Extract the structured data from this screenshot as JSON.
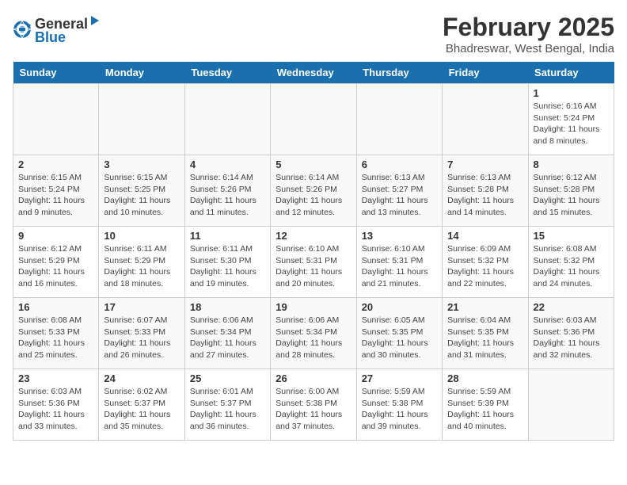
{
  "app": {
    "name_general": "General",
    "name_blue": "Blue"
  },
  "title": "February 2025",
  "subtitle": "Bhadreswar, West Bengal, India",
  "days_of_week": [
    "Sunday",
    "Monday",
    "Tuesday",
    "Wednesday",
    "Thursday",
    "Friday",
    "Saturday"
  ],
  "weeks": [
    [
      {
        "day": "",
        "info": ""
      },
      {
        "day": "",
        "info": ""
      },
      {
        "day": "",
        "info": ""
      },
      {
        "day": "",
        "info": ""
      },
      {
        "day": "",
        "info": ""
      },
      {
        "day": "",
        "info": ""
      },
      {
        "day": "1",
        "info": "Sunrise: 6:16 AM\nSunset: 5:24 PM\nDaylight: 11 hours and 8 minutes."
      }
    ],
    [
      {
        "day": "2",
        "info": "Sunrise: 6:15 AM\nSunset: 5:24 PM\nDaylight: 11 hours and 9 minutes."
      },
      {
        "day": "3",
        "info": "Sunrise: 6:15 AM\nSunset: 5:25 PM\nDaylight: 11 hours and 10 minutes."
      },
      {
        "day": "4",
        "info": "Sunrise: 6:14 AM\nSunset: 5:26 PM\nDaylight: 11 hours and 11 minutes."
      },
      {
        "day": "5",
        "info": "Sunrise: 6:14 AM\nSunset: 5:26 PM\nDaylight: 11 hours and 12 minutes."
      },
      {
        "day": "6",
        "info": "Sunrise: 6:13 AM\nSunset: 5:27 PM\nDaylight: 11 hours and 13 minutes."
      },
      {
        "day": "7",
        "info": "Sunrise: 6:13 AM\nSunset: 5:28 PM\nDaylight: 11 hours and 14 minutes."
      },
      {
        "day": "8",
        "info": "Sunrise: 6:12 AM\nSunset: 5:28 PM\nDaylight: 11 hours and 15 minutes."
      }
    ],
    [
      {
        "day": "9",
        "info": "Sunrise: 6:12 AM\nSunset: 5:29 PM\nDaylight: 11 hours and 16 minutes."
      },
      {
        "day": "10",
        "info": "Sunrise: 6:11 AM\nSunset: 5:29 PM\nDaylight: 11 hours and 18 minutes."
      },
      {
        "day": "11",
        "info": "Sunrise: 6:11 AM\nSunset: 5:30 PM\nDaylight: 11 hours and 19 minutes."
      },
      {
        "day": "12",
        "info": "Sunrise: 6:10 AM\nSunset: 5:31 PM\nDaylight: 11 hours and 20 minutes."
      },
      {
        "day": "13",
        "info": "Sunrise: 6:10 AM\nSunset: 5:31 PM\nDaylight: 11 hours and 21 minutes."
      },
      {
        "day": "14",
        "info": "Sunrise: 6:09 AM\nSunset: 5:32 PM\nDaylight: 11 hours and 22 minutes."
      },
      {
        "day": "15",
        "info": "Sunrise: 6:08 AM\nSunset: 5:32 PM\nDaylight: 11 hours and 24 minutes."
      }
    ],
    [
      {
        "day": "16",
        "info": "Sunrise: 6:08 AM\nSunset: 5:33 PM\nDaylight: 11 hours and 25 minutes."
      },
      {
        "day": "17",
        "info": "Sunrise: 6:07 AM\nSunset: 5:33 PM\nDaylight: 11 hours and 26 minutes."
      },
      {
        "day": "18",
        "info": "Sunrise: 6:06 AM\nSunset: 5:34 PM\nDaylight: 11 hours and 27 minutes."
      },
      {
        "day": "19",
        "info": "Sunrise: 6:06 AM\nSunset: 5:34 PM\nDaylight: 11 hours and 28 minutes."
      },
      {
        "day": "20",
        "info": "Sunrise: 6:05 AM\nSunset: 5:35 PM\nDaylight: 11 hours and 30 minutes."
      },
      {
        "day": "21",
        "info": "Sunrise: 6:04 AM\nSunset: 5:35 PM\nDaylight: 11 hours and 31 minutes."
      },
      {
        "day": "22",
        "info": "Sunrise: 6:03 AM\nSunset: 5:36 PM\nDaylight: 11 hours and 32 minutes."
      }
    ],
    [
      {
        "day": "23",
        "info": "Sunrise: 6:03 AM\nSunset: 5:36 PM\nDaylight: 11 hours and 33 minutes."
      },
      {
        "day": "24",
        "info": "Sunrise: 6:02 AM\nSunset: 5:37 PM\nDaylight: 11 hours and 35 minutes."
      },
      {
        "day": "25",
        "info": "Sunrise: 6:01 AM\nSunset: 5:37 PM\nDaylight: 11 hours and 36 minutes."
      },
      {
        "day": "26",
        "info": "Sunrise: 6:00 AM\nSunset: 5:38 PM\nDaylight: 11 hours and 37 minutes."
      },
      {
        "day": "27",
        "info": "Sunrise: 5:59 AM\nSunset: 5:38 PM\nDaylight: 11 hours and 39 minutes."
      },
      {
        "day": "28",
        "info": "Sunrise: 5:59 AM\nSunset: 5:39 PM\nDaylight: 11 hours and 40 minutes."
      },
      {
        "day": "",
        "info": ""
      }
    ]
  ]
}
